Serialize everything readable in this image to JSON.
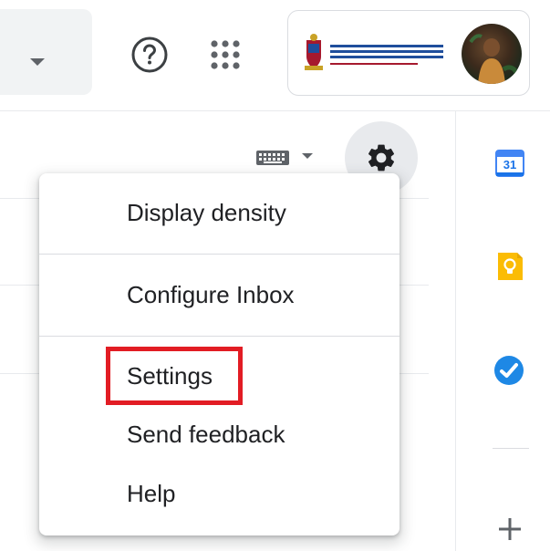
{
  "header": {
    "help_icon": "help-circle-icon",
    "apps_icon": "apps-grid-icon",
    "search_options_icon": "caret-down-icon",
    "account": {
      "logo_lines": [
        "UNIVERSITEIT VAN PRETORIA",
        "UNIVERSITY OF PRETORIA",
        "YUNIBESITHI YA PRETORIA"
      ],
      "logo_motto": "Denkleiers • Leading Minds • Dikgopolo tša Dihlalefi"
    }
  },
  "toolbar": {
    "keyboard_icon": "keyboard-icon",
    "settings_icon": "gear-icon"
  },
  "menu": {
    "items": [
      {
        "label": "Display density"
      },
      {
        "label": "Configure Inbox"
      },
      {
        "label": "Settings"
      },
      {
        "label": "Send feedback"
      },
      {
        "label": "Help"
      }
    ],
    "highlight_color": "#e21c24"
  },
  "side_panel": {
    "calendar": {
      "icon": "calendar-icon",
      "day": "31"
    },
    "keep_icon": "keep-bulb-icon",
    "tasks_icon": "tasks-check-icon",
    "add_icon": "plus-icon"
  },
  "colors": {
    "accent_blue": "#4285f4",
    "keep_yellow": "#fbbc04",
    "tasks_blue": "#1e88e5"
  }
}
